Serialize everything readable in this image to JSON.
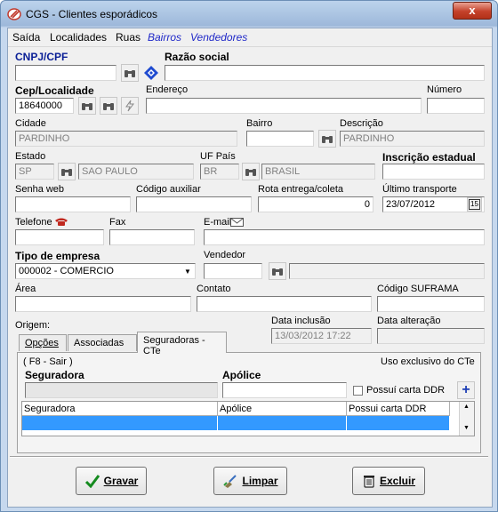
{
  "window": {
    "title": "CGS - Clientes esporádicos",
    "close": "x"
  },
  "menu": [
    {
      "label": "Saída"
    },
    {
      "label": "Localidades"
    },
    {
      "label": "Ruas"
    },
    {
      "label": "Bairros"
    },
    {
      "label": "Vendedores"
    }
  ],
  "form": {
    "cnpj_label": "CNPJ/CPF",
    "cnpj_value": "",
    "razao_label": "Razão social",
    "razao_value": "",
    "cep_label": "Cep/Localidade",
    "cep_value": "18640000",
    "endereco_label": "Endereço",
    "endereco_value": "",
    "numero_label": "Número",
    "numero_value": "",
    "cidade_label": "Cidade",
    "cidade_value": "PARDINHO",
    "bairro_label": "Bairro",
    "bairro_value": "",
    "descricao_label": "Descrição",
    "descricao_value": "PARDINHO",
    "estado_label": "Estado",
    "estado_code": "SP",
    "estado_name": "SAO PAULO",
    "uf_label": "UF País",
    "uf_code": "BR",
    "uf_name": "BRASIL",
    "inscricao_label": "Inscrição estadual",
    "inscricao_value": "",
    "senha_label": "Senha web",
    "senha_value": "",
    "codigo_aux_label": "Código auxiliar",
    "codigo_aux_value": "",
    "rota_label": "Rota entrega/coleta",
    "rota_value": "0",
    "ultimo_label": "Último transporte",
    "ultimo_value": "23/07/2012",
    "calendar": "15",
    "telefone_label": "Telefone",
    "telefone_value": "",
    "fax_label": "Fax",
    "fax_value": "",
    "email_label": "E-mail",
    "email_value": "",
    "tipo_label": "Tipo de empresa",
    "tipo_value": "000002 - COMERCIO",
    "vendedor_label": "Vendedor",
    "vendedor_value": "",
    "area_label": "Área",
    "area_value": "",
    "contato_label": "Contato",
    "contato_value": "",
    "suframa_label": "Código SUFRAMA",
    "suframa_value": "",
    "origem_label": "Origem:",
    "data_inclusao_label": "Data inclusão",
    "data_inclusao_value": "13/03/2012 17:22",
    "data_alteracao_label": "Data alteração",
    "data_alteracao_value": ""
  },
  "tabs": [
    {
      "label": "Opções"
    },
    {
      "label": "Associadas"
    },
    {
      "label": "Seguradoras - CTe"
    }
  ],
  "tab_panel": {
    "hint": "( F8 - Sair )",
    "exclusive": "Uso exclusivo do CTe",
    "seguradora_label": "Seguradora",
    "seguradora_value": "",
    "apolice_label": "Apólice",
    "apolice_value": "",
    "checkbox_label": "Possuí carta DDR",
    "add": "+",
    "columns": [
      "Seguradora",
      "Apólice",
      "Possui carta DDR"
    ]
  },
  "buttons": {
    "save": "Gravar",
    "clear": "Limpar",
    "delete": "Excluir"
  },
  "colors": {
    "accent_blue": "#0a1f96",
    "selection": "#3399ff",
    "close_red": "#c4412a"
  }
}
